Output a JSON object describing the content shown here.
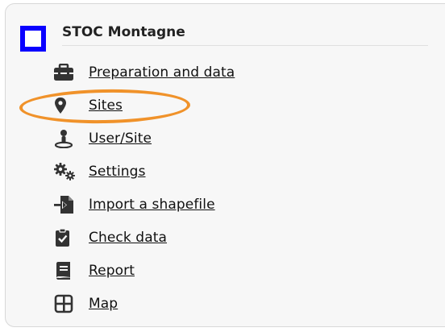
{
  "panel": {
    "title": "STOC Montagne"
  },
  "menu": {
    "items": [
      {
        "label": "Preparation and data",
        "icon": "briefcase-icon"
      },
      {
        "label": "Sites",
        "icon": "map-marker-icon"
      },
      {
        "label": "User/Site",
        "icon": "user-location-icon"
      },
      {
        "label": "Settings",
        "icon": "gears-icon"
      },
      {
        "label": "Import a shapefile",
        "icon": "file-import-icon"
      },
      {
        "label": "Check data",
        "icon": "clipboard-check-icon"
      },
      {
        "label": "Report",
        "icon": "book-icon"
      },
      {
        "label": "Map",
        "icon": "grid-map-icon"
      }
    ]
  },
  "highlight": {
    "color": "#f0922a",
    "target": "Sites"
  },
  "colors": {
    "accent": "#0a00ff",
    "icon": "#333333",
    "text": "#111111"
  }
}
